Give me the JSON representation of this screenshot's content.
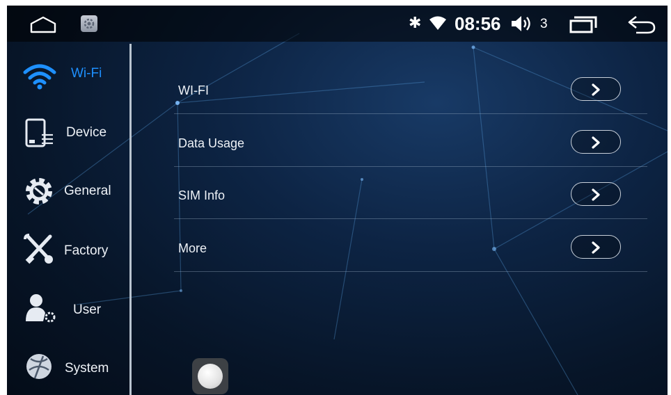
{
  "status_bar": {
    "bluetooth_icon": "bluetooth-icon",
    "bluetooth_glyph": "✱",
    "time": "08:56",
    "volume_level": "3"
  },
  "sidebar": {
    "items": [
      {
        "label": "Wi-Fi",
        "icon": "wifi-icon",
        "active": true
      },
      {
        "label": "Device",
        "icon": "device-icon"
      },
      {
        "label": "General",
        "icon": "gear-icon"
      },
      {
        "label": "Factory",
        "icon": "tools-icon"
      },
      {
        "label": "User",
        "icon": "user-settings-icon"
      },
      {
        "label": "System",
        "icon": "system-icon"
      }
    ]
  },
  "main": {
    "rows": [
      {
        "label": "WI-FI"
      },
      {
        "label": "Data Usage"
      },
      {
        "label": "SIM Info"
      },
      {
        "label": "More"
      }
    ]
  },
  "colors": {
    "accent": "#1e90ff",
    "text": "#eef2f7",
    "background": "#0d2444"
  }
}
